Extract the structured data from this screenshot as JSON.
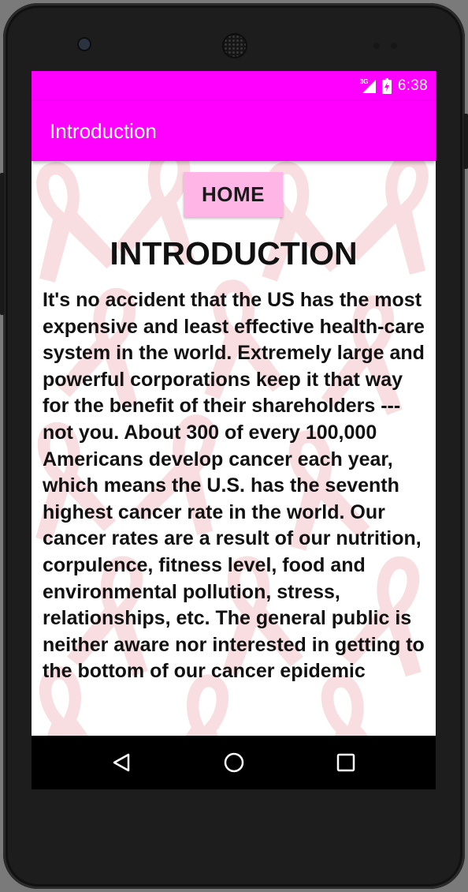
{
  "status_bar": {
    "network": "3G",
    "time": "6:38",
    "icons": [
      "signal-icon",
      "battery-icon"
    ]
  },
  "app_bar": {
    "title": "Introduction"
  },
  "content": {
    "home_button": "HOME",
    "heading": "INTRODUCTION",
    "body": "It's no accident that the US has the most expensive and least effective health-care system in the world. Extremely large and powerful corporations keep it that way for the benefit of their shareholders --- not you. About 300 of every 100,000 Americans develop cancer each year, which means the U.S. has the seventh highest cancer rate in the world. Our cancer rates are a result of our nutrition, corpulence, fitness level, food and environmental pollution, stress, relationships, etc. The general public is neither aware nor interested in getting to the bottom of our cancer epidemic"
  },
  "nav_bar": {
    "icons": [
      "back-icon",
      "home-icon",
      "recents-icon"
    ]
  },
  "colors": {
    "accent": "#ff00ff",
    "button_bg": "#ffb6e6",
    "ribbon": "#f3b0b8",
    "nav_bg": "#000000"
  }
}
